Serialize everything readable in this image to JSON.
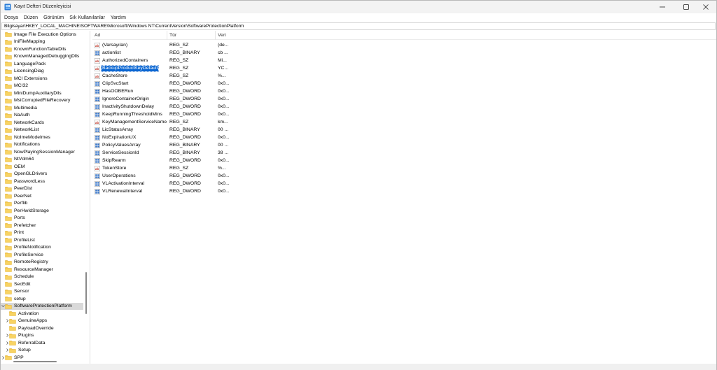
{
  "window": {
    "title": "Kayıt Defteri Düzenleyicisi",
    "accent_color": "#0a66d2"
  },
  "menu": [
    "Dosya",
    "Düzen",
    "Görünüm",
    "Sık Kullanılanlar",
    "Yardım"
  ],
  "address": "Bilgisayar\\HKEY_LOCAL_MACHINE\\SOFTWARE\\Microsoft\\Windows NT\\CurrentVersion\\SoftwareProtectionPlatform",
  "tree": {
    "items": [
      {
        "label": "Image File Execution Options",
        "level": 0,
        "expandable": false
      },
      {
        "label": "IniFileMapping",
        "level": 0,
        "expandable": false
      },
      {
        "label": "KnownFunctionTableDlls",
        "level": 0,
        "expandable": false
      },
      {
        "label": "KnownManagedDebuggingDlls",
        "level": 0,
        "expandable": false
      },
      {
        "label": "LanguagePack",
        "level": 0,
        "expandable": false
      },
      {
        "label": "LicensingDiag",
        "level": 0,
        "expandable": false
      },
      {
        "label": "MCI Extensions",
        "level": 0,
        "expandable": false
      },
      {
        "label": "MCI32",
        "level": 0,
        "expandable": false
      },
      {
        "label": "MiniDumpAuxiliaryDlls",
        "level": 0,
        "expandable": false
      },
      {
        "label": "MsiCorruptedFileRecovery",
        "level": 0,
        "expandable": false
      },
      {
        "label": "Multimedia",
        "level": 0,
        "expandable": false
      },
      {
        "label": "NaAuth",
        "level": 0,
        "expandable": false
      },
      {
        "label": "NetworkCards",
        "level": 0,
        "expandable": false
      },
      {
        "label": "NetworkList",
        "level": 0,
        "expandable": false
      },
      {
        "label": "NoImeModeImes",
        "level": 0,
        "expandable": false
      },
      {
        "label": "Notifications",
        "level": 0,
        "expandable": false
      },
      {
        "label": "NowPlayingSessionManager",
        "level": 0,
        "expandable": false
      },
      {
        "label": "NtVdm64",
        "level": 0,
        "expandable": false
      },
      {
        "label": "OEM",
        "level": 0,
        "expandable": false
      },
      {
        "label": "OpenGLDrivers",
        "level": 0,
        "expandable": false
      },
      {
        "label": "PasswordLess",
        "level": 0,
        "expandable": false
      },
      {
        "label": "PeerDist",
        "level": 0,
        "expandable": false
      },
      {
        "label": "PeerNet",
        "level": 0,
        "expandable": false
      },
      {
        "label": "Perflib",
        "level": 0,
        "expandable": false
      },
      {
        "label": "PerHwIdStorage",
        "level": 0,
        "expandable": false
      },
      {
        "label": "Ports",
        "level": 0,
        "expandable": false
      },
      {
        "label": "Prefetcher",
        "level": 0,
        "expandable": false
      },
      {
        "label": "Print",
        "level": 0,
        "expandable": false
      },
      {
        "label": "ProfileList",
        "level": 0,
        "expandable": false
      },
      {
        "label": "ProfileNotification",
        "level": 0,
        "expandable": false
      },
      {
        "label": "ProfileService",
        "level": 0,
        "expandable": false
      },
      {
        "label": "RemoteRegistry",
        "level": 0,
        "expandable": false
      },
      {
        "label": "ResourceManager",
        "level": 0,
        "expandable": false
      },
      {
        "label": "Schedule",
        "level": 0,
        "expandable": false
      },
      {
        "label": "SecEdit",
        "level": 0,
        "expandable": false
      },
      {
        "label": "Sensor",
        "level": 0,
        "expandable": false
      },
      {
        "label": "setup",
        "level": 0,
        "expandable": false
      },
      {
        "label": "SoftwareProtectionPlatform",
        "level": 0,
        "expandable": true,
        "expanded": true,
        "selected": true
      },
      {
        "label": "Activation",
        "level": 1,
        "expandable": false
      },
      {
        "label": "GenuineApps",
        "level": 1,
        "expandable": true
      },
      {
        "label": "PayloadOverride",
        "level": 1,
        "expandable": false
      },
      {
        "label": "Plugins",
        "level": 1,
        "expandable": true
      },
      {
        "label": "ReferralData",
        "level": 1,
        "expandable": true
      },
      {
        "label": "Setup",
        "level": 1,
        "expandable": true
      },
      {
        "label": "SPP",
        "level": 0,
        "expandable": true
      }
    ]
  },
  "list": {
    "columns": {
      "name": "Ad",
      "type": "Tür",
      "data": "Veri"
    },
    "rows": [
      {
        "name": "(Varsayılan)",
        "type": "REG_SZ",
        "data": "(de...",
        "icon": "string-value-icon"
      },
      {
        "name": "actionlist",
        "type": "REG_BINARY",
        "data": "cb ...",
        "icon": "binary-value-icon"
      },
      {
        "name": "AuthorizedContainers",
        "type": "REG_SZ",
        "data": "Mi...",
        "icon": "string-value-icon"
      },
      {
        "name": "BackupProductKeyDefault",
        "type": "REG_SZ",
        "data": "YC...",
        "icon": "string-value-icon",
        "selected": true
      },
      {
        "name": "CacheStore",
        "type": "REG_SZ",
        "data": "%...",
        "icon": "string-value-icon"
      },
      {
        "name": "ClipSvcStart",
        "type": "REG_DWORD",
        "data": "0x0...",
        "icon": "binary-value-icon"
      },
      {
        "name": "HasOOBERun",
        "type": "REG_DWORD",
        "data": "0x0...",
        "icon": "binary-value-icon"
      },
      {
        "name": "IgnoreContainerOrigin",
        "type": "REG_DWORD",
        "data": "0x0...",
        "icon": "binary-value-icon"
      },
      {
        "name": "InactivityShutdownDelay",
        "type": "REG_DWORD",
        "data": "0x0...",
        "icon": "binary-value-icon"
      },
      {
        "name": "KeepRunningThresholdMins",
        "type": "REG_DWORD",
        "data": "0x0...",
        "icon": "binary-value-icon"
      },
      {
        "name": "KeyManagementServiceName",
        "type": "REG_SZ",
        "data": "km...",
        "icon": "string-value-icon"
      },
      {
        "name": "LicStatusArray",
        "type": "REG_BINARY",
        "data": "00 ...",
        "icon": "binary-value-icon"
      },
      {
        "name": "NoExpirationUX",
        "type": "REG_DWORD",
        "data": "0x0...",
        "icon": "binary-value-icon"
      },
      {
        "name": "PolicyValuesArray",
        "type": "REG_BINARY",
        "data": "00 ...",
        "icon": "binary-value-icon"
      },
      {
        "name": "ServiceSessionId",
        "type": "REG_BINARY",
        "data": "38 ...",
        "icon": "binary-value-icon"
      },
      {
        "name": "SkipRearm",
        "type": "REG_DWORD",
        "data": "0x0...",
        "icon": "binary-value-icon"
      },
      {
        "name": "TokenStore",
        "type": "REG_SZ",
        "data": "%...",
        "icon": "string-value-icon"
      },
      {
        "name": "UserOperations",
        "type": "REG_DWORD",
        "data": "0x0...",
        "icon": "binary-value-icon"
      },
      {
        "name": "VLActivationInterval",
        "type": "REG_DWORD",
        "data": "0x0...",
        "icon": "binary-value-icon"
      },
      {
        "name": "VLRenewalInterval",
        "type": "REG_DWORD",
        "data": "0x0...",
        "icon": "binary-value-icon"
      }
    ]
  }
}
